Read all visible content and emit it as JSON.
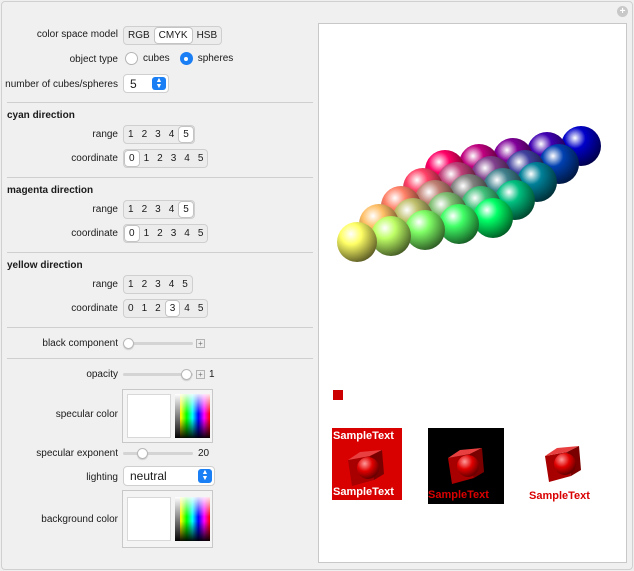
{
  "controls": {
    "color_space": {
      "label": "color space model",
      "options": [
        "RGB",
        "CMYK",
        "HSB"
      ],
      "selected": "CMYK"
    },
    "object_type": {
      "label": "object type",
      "options": [
        "cubes",
        "spheres"
      ],
      "selected": "spheres"
    },
    "count": {
      "label": "number of cubes/spheres",
      "value": "5"
    },
    "cyan": {
      "title": "cyan direction",
      "range_label": "range",
      "range_options": [
        "1",
        "2",
        "3",
        "4",
        "5"
      ],
      "range_selected": "5",
      "coord_label": "coordinate",
      "coord_options": [
        "0",
        "1",
        "2",
        "3",
        "4",
        "5"
      ],
      "coord_selected": "0"
    },
    "magenta": {
      "title": "magenta direction",
      "range_label": "range",
      "range_options": [
        "1",
        "2",
        "3",
        "4",
        "5"
      ],
      "range_selected": "5",
      "coord_label": "coordinate",
      "coord_options": [
        "0",
        "1",
        "2",
        "3",
        "4",
        "5"
      ],
      "coord_selected": "0"
    },
    "yellow": {
      "title": "yellow direction",
      "range_label": "range",
      "range_options": [
        "1",
        "2",
        "3",
        "4",
        "5"
      ],
      "range_selected": "1",
      "coord_label": "coordinate",
      "coord_options": [
        "0",
        "1",
        "2",
        "3",
        "4",
        "5"
      ],
      "coord_selected": "3"
    },
    "black": {
      "label": "black component",
      "level": 0
    },
    "opacity": {
      "label": "opacity",
      "value": "1",
      "level": 1
    },
    "specular_color": {
      "label": "specular color"
    },
    "specular_exponent": {
      "label": "specular exponent",
      "value": "20",
      "level": 0.2
    },
    "lighting": {
      "label": "lighting",
      "value": "neutral"
    },
    "background_color": {
      "label": "background color"
    }
  },
  "output": {
    "samples": [
      {
        "top": "SampleText",
        "bottom": "SampleText",
        "bg": "#d90000",
        "text": "#ffffff"
      },
      {
        "top": "",
        "bottom": "SampleText",
        "bg": "#000000",
        "text": "#d90000"
      },
      {
        "top": "",
        "bottom": "SampleText",
        "bg": "#ffffff",
        "text": "#d90000"
      }
    ],
    "legend_color": "#cc0000"
  },
  "icons": {
    "corner": "plus-circle-icon"
  }
}
